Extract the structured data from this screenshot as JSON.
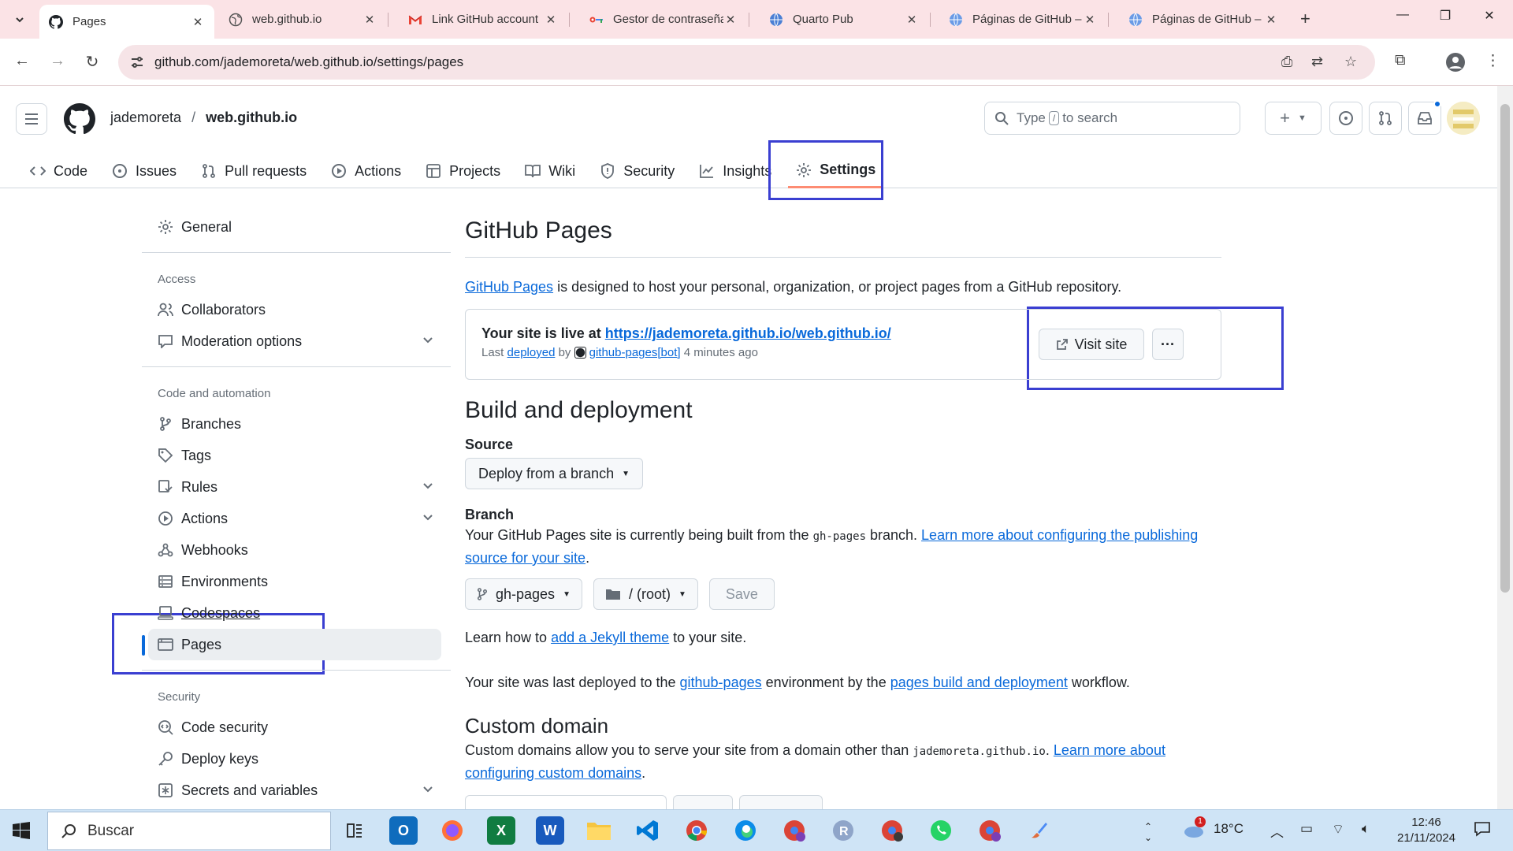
{
  "browser": {
    "tabs": [
      {
        "title": "Pages",
        "active": true
      },
      {
        "title": "web.github.io"
      },
      {
        "title": "Link GitHub account"
      },
      {
        "title": "Gestor de contraseñas"
      },
      {
        "title": "Quarto Pub"
      },
      {
        "title": "Páginas de GitHub –"
      },
      {
        "title": "Páginas de GitHub –"
      }
    ],
    "url": "github.com/jademoreta/web.github.io/settings/pages"
  },
  "header": {
    "owner": "jademoreta",
    "separator": "/",
    "repo": "web.github.io",
    "search_prefix": "Type",
    "search_key": "/",
    "search_suffix": "to search"
  },
  "repo_tabs": [
    {
      "label": "Code",
      "icon": "code-icon"
    },
    {
      "label": "Issues",
      "icon": "issue-icon"
    },
    {
      "label": "Pull requests",
      "icon": "pull-request-icon"
    },
    {
      "label": "Actions",
      "icon": "play-icon"
    },
    {
      "label": "Projects",
      "icon": "table-icon"
    },
    {
      "label": "Wiki",
      "icon": "book-icon"
    },
    {
      "label": "Security",
      "icon": "shield-icon"
    },
    {
      "label": "Insights",
      "icon": "graph-icon"
    },
    {
      "label": "Settings",
      "icon": "gear-icon",
      "selected": true
    }
  ],
  "sidebar": {
    "general": "General",
    "access_heading": "Access",
    "collaborators": "Collaborators",
    "moderation": "Moderation options",
    "automation_heading": "Code and automation",
    "branches": "Branches",
    "tags": "Tags",
    "rules": "Rules",
    "actions": "Actions",
    "webhooks": "Webhooks",
    "environments": "Environments",
    "codespaces": "Codespaces",
    "pages": "Pages",
    "security_heading": "Security",
    "code_security": "Code security",
    "deploy_keys": "Deploy keys",
    "secrets": "Secrets and variables"
  },
  "main": {
    "title": "GitHub Pages",
    "intro_link": "GitHub Pages",
    "intro_text": " is designed to host your personal, organization, or project pages from a GitHub repository.",
    "live_prefix": "Your site is live at ",
    "live_url": "https://jademoreta.github.io/web.github.io/",
    "last": "Last ",
    "deployed": "deployed",
    "by": " by ",
    "bot": "github-pages[bot]",
    "ago": " 4 minutes ago",
    "visit_site": "Visit site",
    "more": "···",
    "build_title": "Build and deployment",
    "source_label": "Source",
    "source_value": "Deploy from a branch",
    "branch_label": "Branch",
    "branch_text_1": "Your GitHub Pages site is currently being built from the ",
    "branch_code": "gh-pages",
    "branch_text_2": " branch. ",
    "branch_link": "Learn more about configuring the publishing source for your site",
    "branch_text_3": ".",
    "branch_select": "gh-pages",
    "folder_select": "/ (root)",
    "save": "Save",
    "jekyll_1": "Learn how to ",
    "jekyll_link": "add a Jekyll theme",
    "jekyll_2": " to your site.",
    "deployed_1": "Your site was last deployed to the ",
    "deployed_link1": "github-pages",
    "deployed_2": " environment by the ",
    "deployed_link2": "pages build and deployment",
    "deployed_3": " workflow.",
    "custom_title": "Custom domain",
    "custom_1": "Custom domains allow you to serve your site from a domain other than ",
    "custom_code": "jademoreta.github.io",
    "custom_2": ". ",
    "custom_link": "Learn more about configuring custom domains",
    "custom_3": "."
  },
  "taskbar": {
    "search": "Buscar",
    "weather": "18°C",
    "time": "12:46",
    "date": "21/11/2024",
    "badge": "1"
  },
  "colors": {
    "accent": "#0969da",
    "annotation": "#3a3fd1",
    "tab_underline": "#fd8c73",
    "chrome": "#fbe3e6"
  }
}
